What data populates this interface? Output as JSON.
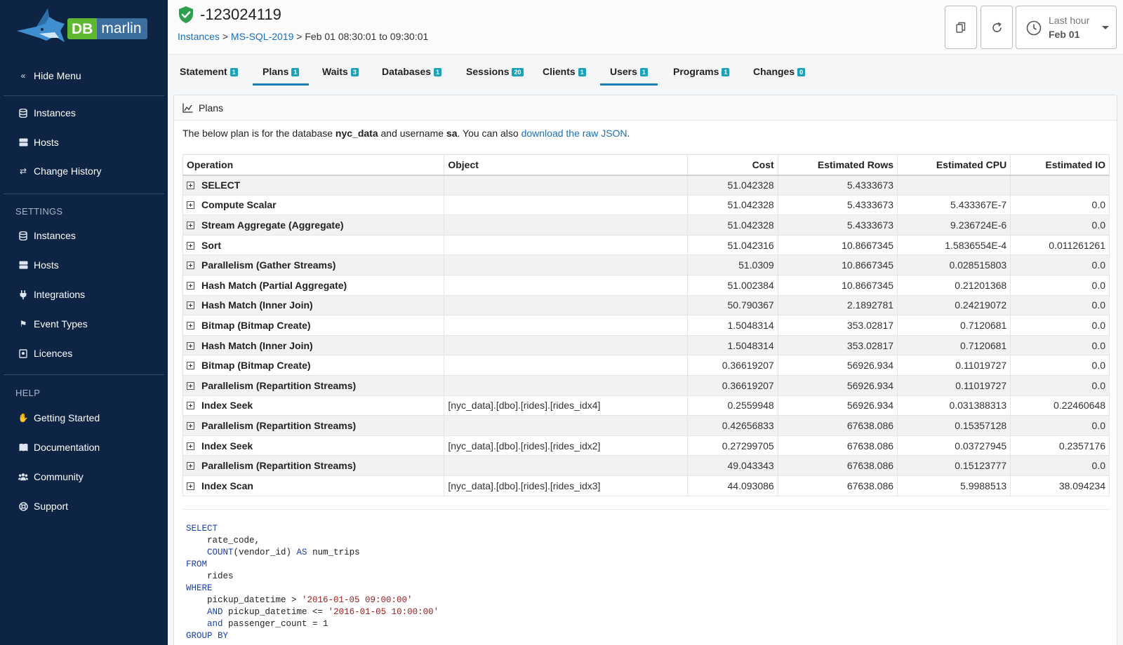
{
  "brand": {
    "db": "DB",
    "name": "marlin"
  },
  "sidebar": {
    "hide_menu": "Hide Menu",
    "main": [
      {
        "label": "Instances",
        "icon": "database-icon"
      },
      {
        "label": "Hosts",
        "icon": "server-icon"
      },
      {
        "label": "Change History",
        "icon": "exchange-icon"
      }
    ],
    "settings_heading": "SETTINGS",
    "settings": [
      {
        "label": "Instances",
        "icon": "database-icon"
      },
      {
        "label": "Hosts",
        "icon": "server-icon"
      },
      {
        "label": "Integrations",
        "icon": "plug-icon"
      },
      {
        "label": "Event Types",
        "icon": "flag-icon"
      },
      {
        "label": "Licences",
        "icon": "license-icon"
      }
    ],
    "help_heading": "HELP",
    "help": [
      {
        "label": "Getting Started",
        "icon": "hand-icon"
      },
      {
        "label": "Documentation",
        "icon": "book-icon"
      },
      {
        "label": "Community",
        "icon": "users-icon"
      },
      {
        "label": "Support",
        "icon": "lifebuoy-icon"
      }
    ]
  },
  "header": {
    "title": "-123024119",
    "breadcrumb": {
      "root": "Instances",
      "sep1": ">",
      "instance": "MS-SQL-2019",
      "sep2": ">",
      "range": "Feb 01 08:30:01 to 09:30:01"
    },
    "time_selector": {
      "line1": "Last hour",
      "line2": "Feb 01"
    }
  },
  "tabs": [
    {
      "label": "Statement",
      "badge": "1"
    },
    {
      "label": "Plans",
      "badge": "1"
    },
    {
      "label": "Waits",
      "badge": "3"
    },
    {
      "label": "Databases",
      "badge": "1"
    },
    {
      "label": "Sessions",
      "badge": "20"
    },
    {
      "label": "Clients",
      "badge": "1"
    },
    {
      "label": "Users",
      "badge": "1"
    },
    {
      "label": "Programs",
      "badge": "1"
    },
    {
      "label": "Changes",
      "badge": "0"
    }
  ],
  "panel": {
    "title": "Plans",
    "intro": {
      "p1": "The below plan is for the database ",
      "database": "nyc_data",
      "p2": " and username ",
      "username": "sa",
      "p3": ". You can also ",
      "link": "download the raw JSON",
      "p4": "."
    },
    "columns": [
      "Operation",
      "Object",
      "Cost",
      "Estimated Rows",
      "Estimated CPU",
      "Estimated IO"
    ],
    "rows": [
      [
        "SELECT",
        "",
        "51.042328",
        "5.4333673",
        "",
        ""
      ],
      [
        "Compute Scalar",
        "",
        "51.042328",
        "5.4333673",
        "5.433367E-7",
        "0.0"
      ],
      [
        "Stream Aggregate (Aggregate)",
        "",
        "51.042328",
        "5.4333673",
        "9.236724E-6",
        "0.0"
      ],
      [
        "Sort",
        "",
        "51.042316",
        "10.8667345",
        "1.5836554E-4",
        "0.011261261"
      ],
      [
        "Parallelism (Gather Streams)",
        "",
        "51.0309",
        "10.8667345",
        "0.028515803",
        "0.0"
      ],
      [
        "Hash Match (Partial Aggregate)",
        "",
        "51.002384",
        "10.8667345",
        "0.21201368",
        "0.0"
      ],
      [
        "Hash Match (Inner Join)",
        "",
        "50.790367",
        "2.1892781",
        "0.24219072",
        "0.0"
      ],
      [
        "Bitmap (Bitmap Create)",
        "",
        "1.5048314",
        "353.02817",
        "0.7120681",
        "0.0"
      ],
      [
        "Hash Match (Inner Join)",
        "",
        "1.5048314",
        "353.02817",
        "0.7120681",
        "0.0"
      ],
      [
        "Bitmap (Bitmap Create)",
        "",
        "0.36619207",
        "56926.934",
        "0.11019727",
        "0.0"
      ],
      [
        "Parallelism (Repartition Streams)",
        "",
        "0.36619207",
        "56926.934",
        "0.11019727",
        "0.0"
      ],
      [
        "Index Seek",
        "[nyc_data].[dbo].[rides].[rides_idx4]",
        "0.2559948",
        "56926.934",
        "0.031388313",
        "0.22460648"
      ],
      [
        "Parallelism (Repartition Streams)",
        "",
        "0.42656833",
        "67638.086",
        "0.15357128",
        "0.0"
      ],
      [
        "Index Seek",
        "[nyc_data].[dbo].[rides].[rides_idx2]",
        "0.27299705",
        "67638.086",
        "0.03727945",
        "0.2357176"
      ],
      [
        "Parallelism (Repartition Streams)",
        "",
        "49.043343",
        "67638.086",
        "0.15123777",
        "0.0"
      ],
      [
        "Index Scan",
        "[nyc_data].[dbo].[rides].[rides_idx3]",
        "44.093086",
        "67638.086",
        "5.9988513",
        "38.094234"
      ]
    ],
    "sql": [
      [
        [
          "kw",
          "SELECT"
        ]
      ],
      [
        [
          "t",
          "    rate_code,"
        ]
      ],
      [
        [
          "t",
          "    "
        ],
        [
          "kw",
          "COUNT"
        ],
        [
          "t",
          "(vendor_id) "
        ],
        [
          "kw",
          "AS"
        ],
        [
          "t",
          " num_trips"
        ]
      ],
      [
        [
          "kw",
          "FROM"
        ]
      ],
      [
        [
          "t",
          "    rides"
        ]
      ],
      [
        [
          "kw",
          "WHERE"
        ]
      ],
      [
        [
          "t",
          "    pickup_datetime > "
        ],
        [
          "str",
          "'2016-01-05 09:00:00'"
        ]
      ],
      [
        [
          "t",
          "    "
        ],
        [
          "kw",
          "AND"
        ],
        [
          "t",
          " pickup_datetime <= "
        ],
        [
          "str",
          "'2016-01-05 10:00:00'"
        ]
      ],
      [
        [
          "t",
          "    "
        ],
        [
          "kw",
          "and"
        ],
        [
          "t",
          " passenger_count = 1"
        ]
      ],
      [
        [
          "kw",
          "GROUP BY"
        ]
      ]
    ]
  },
  "colors": {
    "sidebar": "#0d2444",
    "accent": "#1e7fbd",
    "badge": "#1ca2b8",
    "ok": "#2e9e4f"
  }
}
